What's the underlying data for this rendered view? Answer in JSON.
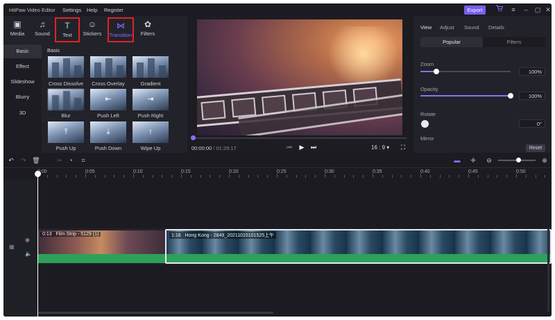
{
  "app": {
    "title": "HitPaw Video Editor"
  },
  "menu": [
    "Settings",
    "Help",
    "Register"
  ],
  "export_label": "Export",
  "window_controls": [
    "cart-icon",
    "hamburger-menu-icon",
    "minimize-icon",
    "maximize-icon",
    "close-icon"
  ],
  "toolbar": [
    {
      "label": "Media",
      "icon": "media-icon"
    },
    {
      "label": "Sound",
      "icon": "music-note-icon"
    },
    {
      "label": "Text",
      "icon": "text-icon"
    },
    {
      "label": "Stickers",
      "icon": "smiley-icon"
    },
    {
      "label": "Transition",
      "icon": "bowtie-icon"
    },
    {
      "label": "Filters",
      "icon": "filters-icon"
    }
  ],
  "categories": [
    "Basic",
    "Effect",
    "Slideshow",
    "Blurry",
    "3D"
  ],
  "selected_category": "Basic",
  "section_title": "Basic",
  "transitions": [
    "Cross Dissolve",
    "Cross Overlay",
    "Gradient",
    "Blur",
    "Push Left",
    "Push Right",
    "Push Up",
    "Push Down",
    "Wipe Up"
  ],
  "preview": {
    "current_time": "00:00:00",
    "total_time": "/ 01:29:17",
    "aspect_ratio": "16 : 9",
    "progress": 0
  },
  "right_panel": {
    "tabs": [
      "View",
      "Adjust",
      "Sound",
      "Details"
    ],
    "selected_tab": "View",
    "segments": [
      "Popular",
      "Filters"
    ],
    "zoom": {
      "label": "Zoom",
      "value": "100%",
      "level": 0.18
    },
    "opacity": {
      "label": "Opacity",
      "value": "100%",
      "level": 1.0
    },
    "rotate": {
      "label": "Rotate",
      "value": "0°"
    },
    "mirror_label": "Mirror",
    "reset_label": "Reset"
  },
  "timeline": {
    "ruler": [
      "0:00",
      "0:05",
      "0:10",
      "0:15",
      "0:20",
      "0:25",
      "0:30",
      "0:35",
      "0:40",
      "0:45",
      "0:50"
    ],
    "zoom_level": 0.55,
    "clips": [
      {
        "duration": "0:13",
        "name": "Film Strip - 5129 (1)"
      },
      {
        "duration": "1:16",
        "name": "Hong Kong - 2849_20211015101525上午"
      }
    ]
  },
  "colors": {
    "accent": "#8a70ff",
    "export": "#7b5cf0",
    "audio": "#2da05a",
    "highlight": "#e02424",
    "bg": "#1b1b21"
  }
}
